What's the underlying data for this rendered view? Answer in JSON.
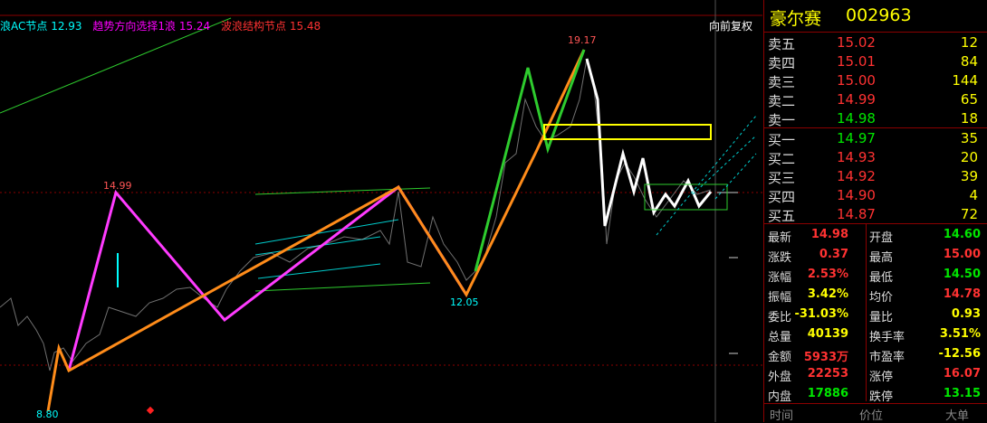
{
  "stock": {
    "name": "豪尔赛",
    "code": "002963"
  },
  "chart": {
    "legend": [
      {
        "text": "浪AC节点 12.93",
        "color": "#00ffff"
      },
      {
        "text": "趋势方向选择1浪 15.24",
        "color": "#ff00ff"
      },
      {
        "text": "波浪结构节点 15.48",
        "color": "#ff3232"
      }
    ],
    "adjust_button": "向前复权",
    "annotations": [
      "19.17",
      "14.99",
      "12.05",
      "8.80"
    ]
  },
  "order_book": {
    "asks": [
      {
        "label": "卖五",
        "price": "15.02",
        "qty": "12",
        "color": "red"
      },
      {
        "label": "卖四",
        "price": "15.01",
        "qty": "84",
        "color": "red"
      },
      {
        "label": "卖三",
        "price": "15.00",
        "qty": "144",
        "color": "red"
      },
      {
        "label": "卖二",
        "price": "14.99",
        "qty": "65",
        "color": "red"
      },
      {
        "label": "卖一",
        "price": "14.98",
        "qty": "18",
        "color": "green"
      }
    ],
    "bids": [
      {
        "label": "买一",
        "price": "14.97",
        "qty": "35",
        "color": "green"
      },
      {
        "label": "买二",
        "price": "14.93",
        "qty": "20",
        "color": "red"
      },
      {
        "label": "买三",
        "price": "14.92",
        "qty": "39",
        "color": "red"
      },
      {
        "label": "买四",
        "price": "14.90",
        "qty": "4",
        "color": "red"
      },
      {
        "label": "买五",
        "price": "14.87",
        "qty": "72",
        "color": "red"
      }
    ]
  },
  "stats": [
    {
      "l1": "最新",
      "v1": "14.98",
      "c1": "red",
      "l2": "开盘",
      "v2": "14.60",
      "c2": "green"
    },
    {
      "l1": "涨跌",
      "v1": "0.37",
      "c1": "red",
      "l2": "最高",
      "v2": "15.00",
      "c2": "red"
    },
    {
      "l1": "涨幅",
      "v1": "2.53%",
      "c1": "red",
      "l2": "最低",
      "v2": "14.50",
      "c2": "green"
    },
    {
      "l1": "振幅",
      "v1": "3.42%",
      "c1": "yellow",
      "l2": "均价",
      "v2": "14.78",
      "c2": "red"
    },
    {
      "l1": "委比",
      "v1": "-31.03%",
      "c1": "yellow",
      "l2": "量比",
      "v2": "0.93",
      "c2": "yellow"
    },
    {
      "l1": "总量",
      "v1": "40139",
      "c1": "yellow",
      "l2": "换手率",
      "v2": "3.51%",
      "c2": "yellow"
    },
    {
      "l1": "金额",
      "v1": "5933万",
      "c1": "red",
      "l2": "市盈率",
      "v2": "-12.56",
      "c2": "yellow"
    },
    {
      "l1": "外盘",
      "v1": "22253",
      "c1": "red",
      "l2": "涨停",
      "v2": "16.07",
      "c2": "red"
    },
    {
      "l1": "内盘",
      "v1": "17886",
      "c1": "green",
      "l2": "跌停",
      "v2": "13.15",
      "c2": "green"
    }
  ],
  "bottom_tabs": [
    "时间",
    "价位",
    "大单"
  ]
}
